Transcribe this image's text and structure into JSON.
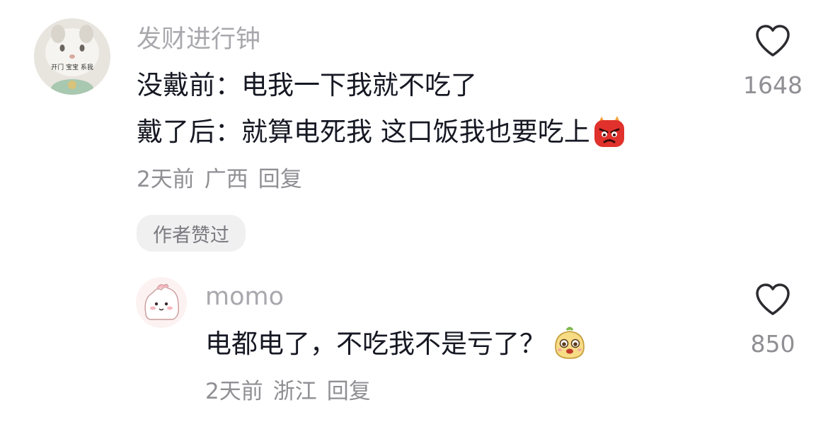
{
  "comments": [
    {
      "username": "发财进行钟",
      "avatar_caption": "开门 宝宝 系我",
      "lines": [
        "没戴前：电我一下我就不吃了",
        "戴了后：就算电死我 这口饭我也要吃上"
      ],
      "line2_emoji": "angry-red-emoji",
      "meta": {
        "time": "2天前",
        "location": "广西",
        "reply": "回复"
      },
      "likes": "1648",
      "badge": "作者赞过"
    },
    {
      "username": "momo",
      "lines": [
        "电都电了，不吃我不是亏了？"
      ],
      "line_emoji": "yellow-face-emoji",
      "meta": {
        "time": "2天前",
        "location": "浙江",
        "reply": "回复"
      },
      "likes": "850"
    }
  ],
  "colors": {
    "username": "#a8a8ad",
    "content": "#161823",
    "meta": "#8f8f94",
    "badge_bg": "#f0f0f1"
  },
  "icons": [
    "heart-outline-icon"
  ]
}
